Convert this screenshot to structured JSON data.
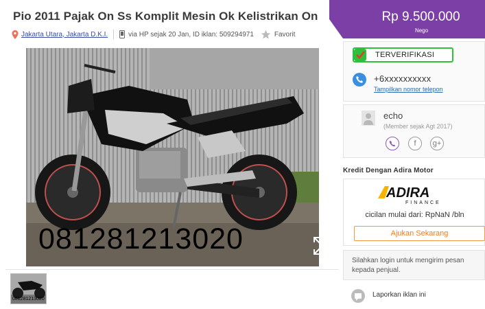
{
  "listing": {
    "title": "Pio 2011 Pajak On Ss Komplit Mesin Ok Kelistrikan On",
    "location": "Jakarta Utara, Jakarta D.K.I.",
    "posted": "via HP sejak 20 Jan, ID iklan: 509294971",
    "favorite_label": "Favorit",
    "photo_overlay_text": "081281213020",
    "thumb_overlay_text": "081281213020"
  },
  "price": {
    "amount": "Rp 9.500.000",
    "note": "Nego"
  },
  "seller": {
    "verified_label": "TERVERIFIKASI",
    "phone_masked": "+6xxxxxxxxxx",
    "show_phone_label": "Tampilkan nomor telepon",
    "name": "echo",
    "member_since": "(Member sejak Agt 2017)"
  },
  "credit": {
    "title": "Kredit Dengan Adira Motor",
    "logo_word": "ADIRA",
    "logo_sub": "FINANCE",
    "installment": "cicilan mulai dari: RpNaN /bln",
    "apply_label": "Ajukan Sekarang"
  },
  "login_notice": "Silahkan login untuk mengirim pesan kepada penjual.",
  "report_label": "Laporkan iklan ini",
  "icons": [
    "location-pin-icon",
    "phone-icon",
    "star-icon",
    "expand-icon",
    "verified-check-icon",
    "phone-circle-icon",
    "avatar-icon",
    "viber-icon",
    "facebook-icon",
    "google-plus-icon",
    "report-icon"
  ],
  "colors": {
    "price_bg": "#7c3fa6",
    "verified_border": "#2fbf3b",
    "link": "#2a6bb8",
    "apply": "#f07d1c"
  }
}
